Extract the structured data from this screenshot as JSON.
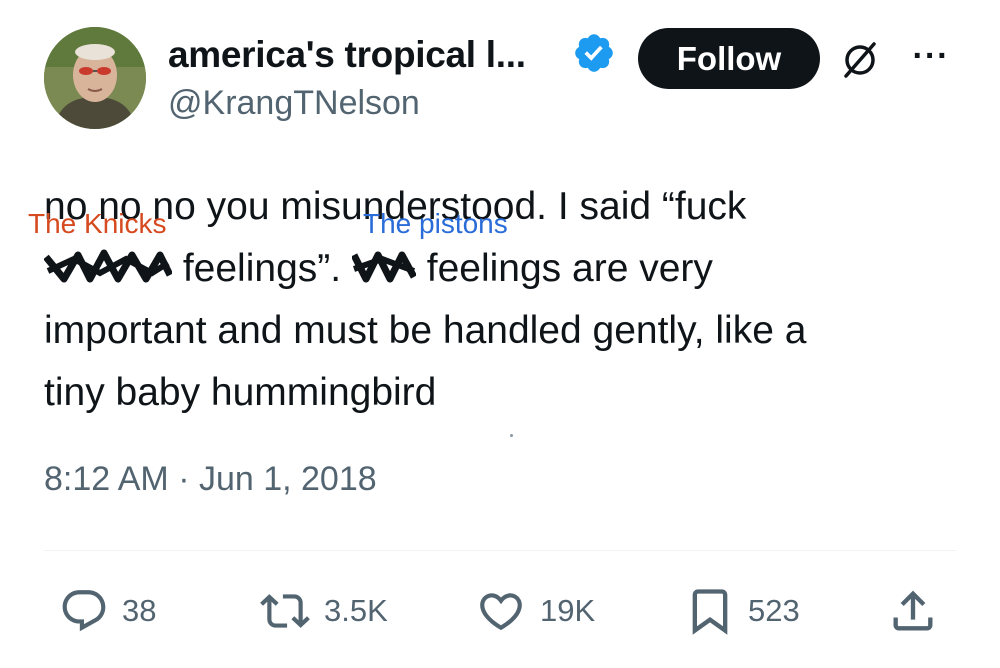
{
  "author": {
    "display_name": "america's tropical l...",
    "handle": "@KrangTNelson",
    "verified": true,
    "follow_label": "Follow"
  },
  "icons": {
    "verified": "verified-badge-icon",
    "grok": "grok-icon",
    "more": "more-options-icon",
    "reply": "reply-icon",
    "retweet": "retweet-icon",
    "like": "like-icon",
    "bookmark": "bookmark-icon",
    "share": "share-icon"
  },
  "tweet": {
    "line1": "no no no you misunderstood. I said “fuck",
    "line2a": " feelings”. ",
    "line2b": " feelings are very",
    "line3": "important and must be handled gently, like a",
    "line4": "tiny baby hummingbird"
  },
  "annotations": {
    "red": "The Knicks",
    "blue": "The pistons"
  },
  "timestamp": "8:12 AM · Jun 1, 2018",
  "stats": {
    "replies": "38",
    "retweets": "3.5K",
    "likes": "19K",
    "bookmarks": "523"
  },
  "colors": {
    "verified_blue": "#1d9bf0",
    "annotation_red": "#d64a1f",
    "annotation_blue": "#2a6cd8",
    "secondary_text": "#536471"
  },
  "more_label": "···"
}
